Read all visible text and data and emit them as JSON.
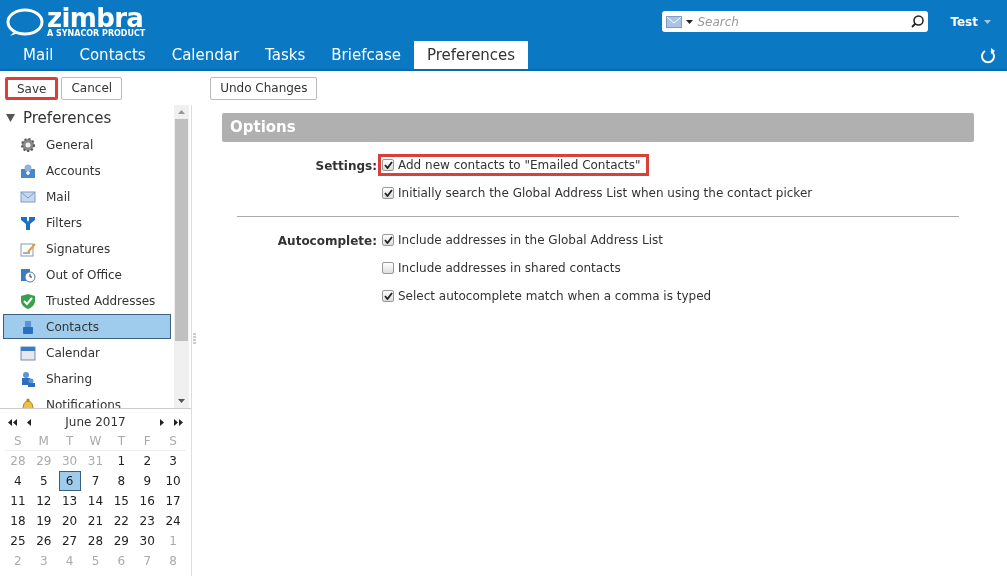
{
  "header": {
    "logo": "zimbra",
    "tagline": "A SYNACOR PRODUCT",
    "search": {
      "placeholder": "Search"
    },
    "user": "Test"
  },
  "tabs": [
    {
      "label": "Mail",
      "selected": false
    },
    {
      "label": "Contacts",
      "selected": false
    },
    {
      "label": "Calendar",
      "selected": false
    },
    {
      "label": "Tasks",
      "selected": false
    },
    {
      "label": "Briefcase",
      "selected": false
    },
    {
      "label": "Preferences",
      "selected": true
    }
  ],
  "toolbar": [
    {
      "label": "Save",
      "highlighted": true
    },
    {
      "label": "Cancel",
      "highlighted": false
    },
    {
      "label": "Undo Changes",
      "highlighted": false
    }
  ],
  "sidebar": {
    "title": "Preferences",
    "expanded": true,
    "items": [
      {
        "label": "General",
        "selected": false
      },
      {
        "label": "Accounts",
        "selected": false
      },
      {
        "label": "Mail",
        "selected": false
      },
      {
        "label": "Filters",
        "selected": false
      },
      {
        "label": "Signatures",
        "selected": false
      },
      {
        "label": "Out of Office",
        "selected": false
      },
      {
        "label": "Trusted Addresses",
        "selected": false
      },
      {
        "label": "Contacts",
        "selected": true
      },
      {
        "label": "Calendar",
        "selected": false
      },
      {
        "label": "Sharing",
        "selected": false
      },
      {
        "label": "Notifications",
        "selected": false
      }
    ]
  },
  "mini_calendar": {
    "title": "June 2017",
    "weekdays": [
      "S",
      "M",
      "T",
      "W",
      "T",
      "F",
      "S"
    ],
    "weeks": [
      [
        {
          "day": "28",
          "other_month": true,
          "selected": false
        },
        {
          "day": "29",
          "other_month": true,
          "selected": false
        },
        {
          "day": "30",
          "other_month": true,
          "selected": false
        },
        {
          "day": "31",
          "other_month": true,
          "selected": false
        },
        {
          "day": "1",
          "other_month": false,
          "selected": false
        },
        {
          "day": "2",
          "other_month": false,
          "selected": false
        },
        {
          "day": "3",
          "other_month": false,
          "selected": false
        }
      ],
      [
        {
          "day": "4",
          "other_month": false,
          "selected": false
        },
        {
          "day": "5",
          "other_month": false,
          "selected": false
        },
        {
          "day": "6",
          "other_month": false,
          "selected": true
        },
        {
          "day": "7",
          "other_month": false,
          "selected": false
        },
        {
          "day": "8",
          "other_month": false,
          "selected": false
        },
        {
          "day": "9",
          "other_month": false,
          "selected": false
        },
        {
          "day": "10",
          "other_month": false,
          "selected": false
        }
      ],
      [
        {
          "day": "11",
          "other_month": false,
          "selected": false
        },
        {
          "day": "12",
          "other_month": false,
          "selected": false
        },
        {
          "day": "13",
          "other_month": false,
          "selected": false
        },
        {
          "day": "14",
          "other_month": false,
          "selected": false
        },
        {
          "day": "15",
          "other_month": false,
          "selected": false
        },
        {
          "day": "16",
          "other_month": false,
          "selected": false
        },
        {
          "day": "17",
          "other_month": false,
          "selected": false
        }
      ],
      [
        {
          "day": "18",
          "other_month": false,
          "selected": false
        },
        {
          "day": "19",
          "other_month": false,
          "selected": false
        },
        {
          "day": "20",
          "other_month": false,
          "selected": false
        },
        {
          "day": "21",
          "other_month": false,
          "selected": false
        },
        {
          "day": "22",
          "other_month": false,
          "selected": false
        },
        {
          "day": "23",
          "other_month": false,
          "selected": false
        },
        {
          "day": "24",
          "other_month": false,
          "selected": false
        }
      ],
      [
        {
          "day": "25",
          "other_month": false,
          "selected": false
        },
        {
          "day": "26",
          "other_month": false,
          "selected": false
        },
        {
          "day": "27",
          "other_month": false,
          "selected": false
        },
        {
          "day": "28",
          "other_month": false,
          "selected": false
        },
        {
          "day": "29",
          "other_month": false,
          "selected": false
        },
        {
          "day": "30",
          "other_month": false,
          "selected": false
        },
        {
          "day": "1",
          "other_month": true,
          "selected": false
        }
      ],
      [
        {
          "day": "2",
          "other_month": true,
          "selected": false
        },
        {
          "day": "3",
          "other_month": true,
          "selected": false
        },
        {
          "day": "4",
          "other_month": true,
          "selected": false
        },
        {
          "day": "5",
          "other_month": true,
          "selected": false
        },
        {
          "day": "6",
          "other_month": true,
          "selected": false
        },
        {
          "day": "7",
          "other_month": true,
          "selected": false
        },
        {
          "day": "8",
          "other_month": true,
          "selected": false
        }
      ]
    ]
  },
  "content": {
    "title": "Options",
    "sections": [
      {
        "label": "Settings:",
        "options": [
          {
            "label": "Add new contacts to \"Emailed Contacts\"",
            "checked": true,
            "highlighted": true
          },
          {
            "label": "Initially search the Global Address List when using the contact picker",
            "checked": true,
            "highlighted": false
          }
        ]
      },
      {
        "label": "Autocomplete:",
        "options": [
          {
            "label": "Include addresses in the Global Address List",
            "checked": true,
            "highlighted": false
          },
          {
            "label": "Include addresses in shared contacts",
            "checked": false,
            "highlighted": false
          },
          {
            "label": "Select autocomplete match when a comma is typed",
            "checked": true,
            "highlighted": false
          }
        ]
      }
    ]
  }
}
